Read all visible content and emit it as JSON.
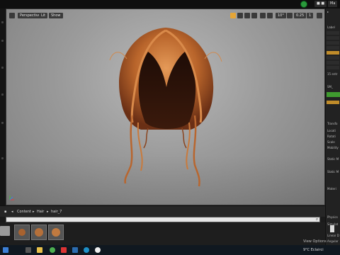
{
  "topbar": {
    "btn_a": "■ ■",
    "btn_b": "Ma"
  },
  "viewport": {
    "perspective_label": "Perspective",
    "lit_label": "Lit",
    "show_label": "Show",
    "snap_angle": "10°",
    "grid_value": "0.25",
    "camera_speed": "1"
  },
  "right_panel": {
    "label_a": "Label",
    "entries_label": "15 entr",
    "sm_label": "SM_",
    "transform_label": "Transfo",
    "location_label": "Locati",
    "rotation_label": "Rotati",
    "scale_label": "Scale",
    "mobility_label": "Mobility",
    "static_label": "Static M",
    "static_mesh_label": "Static M",
    "materials_label": "Materi",
    "physics_label": "Physics",
    "simulate_label": "Simulat",
    "linear_label": "Linear D",
    "angular_label": "Angular"
  },
  "content_browser": {
    "crumbs": [
      "Content",
      "Hair",
      "hair_7"
    ],
    "view_options": "View Options"
  },
  "taskbar": {
    "weather": "9°C Eclairci"
  },
  "colors": {
    "accent_orange": "#e5a536",
    "add_green": "#3f9a2f",
    "play_green": "#2a9a3b"
  }
}
